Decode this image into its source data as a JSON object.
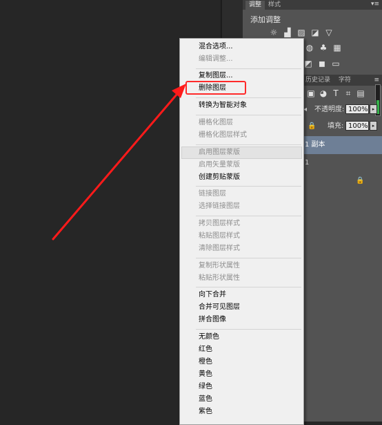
{
  "adjust_panel": {
    "tabs": [
      "调整",
      "样式"
    ],
    "title": "添加调整"
  },
  "layers_panel": {
    "tabs": [
      "历史记录",
      "字符"
    ],
    "opacity_label": "不透明度:",
    "opacity_value": "100%",
    "fill_label": "填充:",
    "fill_value": "100%",
    "layers": [
      {
        "name": "1 副本"
      },
      {
        "name": "1"
      }
    ]
  },
  "context_menu": {
    "items": [
      {
        "label": "混合选项...",
        "enabled": true
      },
      {
        "label": "编辑调整...",
        "enabled": false
      },
      {
        "label": "复制图层...",
        "enabled": true
      },
      {
        "label": "删除图层",
        "enabled": true
      },
      {
        "label": "转换为智能对象",
        "enabled": true
      },
      {
        "label": "栅格化图层",
        "enabled": false
      },
      {
        "label": "栅格化图层样式",
        "enabled": false
      },
      {
        "label": "启用图层蒙版",
        "enabled": false
      },
      {
        "label": "启用矢量蒙版",
        "enabled": false
      },
      {
        "label": "创建剪贴蒙版",
        "enabled": true
      },
      {
        "label": "链接图层",
        "enabled": false
      },
      {
        "label": "选择链接图层",
        "enabled": false
      },
      {
        "label": "拷贝图层样式",
        "enabled": false
      },
      {
        "label": "粘贴图层样式",
        "enabled": false
      },
      {
        "label": "清除图层样式",
        "enabled": false
      },
      {
        "label": "复制形状属性",
        "enabled": false
      },
      {
        "label": "粘贴形状属性",
        "enabled": false
      },
      {
        "label": "向下合并",
        "enabled": true
      },
      {
        "label": "合并可见图层",
        "enabled": true
      },
      {
        "label": "拼合图像",
        "enabled": true
      },
      {
        "label": "无颜色",
        "enabled": true
      },
      {
        "label": "红色",
        "enabled": true
      },
      {
        "label": "橙色",
        "enabled": true
      },
      {
        "label": "黄色",
        "enabled": true
      },
      {
        "label": "绿色",
        "enabled": true
      },
      {
        "label": "蓝色",
        "enabled": true
      },
      {
        "label": "紫色",
        "enabled": true
      }
    ]
  },
  "colors": {
    "highlight_box": "#ff2a2a",
    "arrow": "#ff1a1a",
    "selected_layer": "#6e7f96"
  }
}
